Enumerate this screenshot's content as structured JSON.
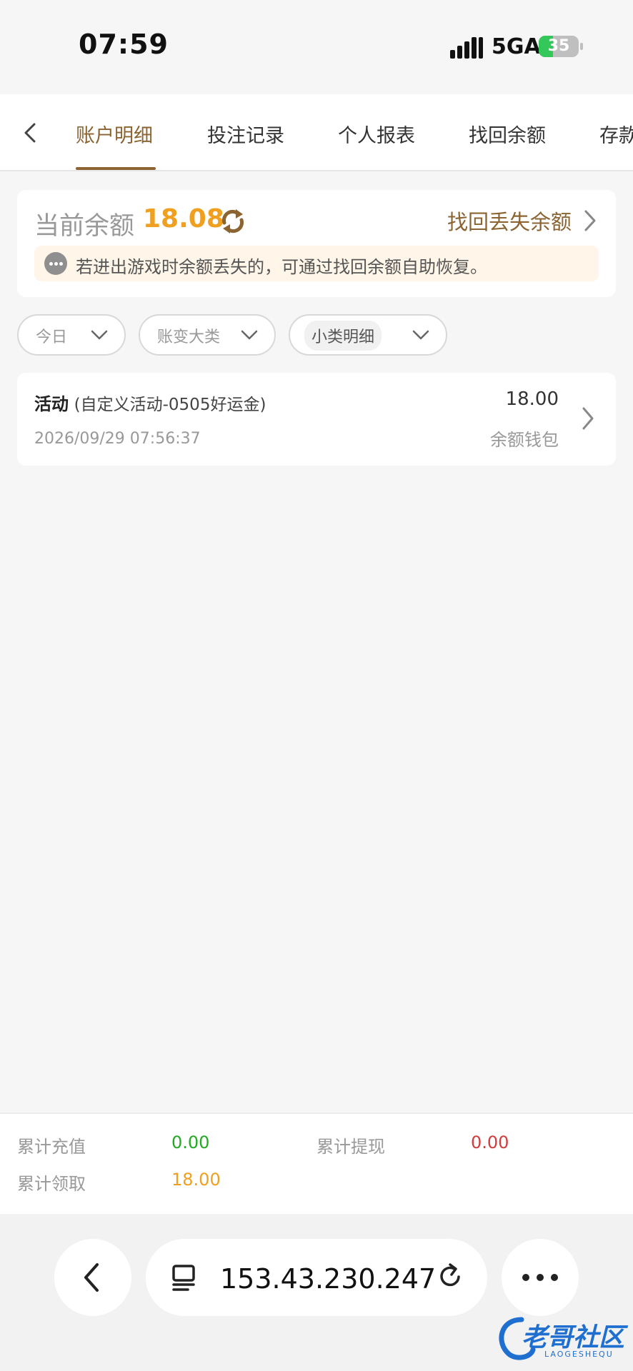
{
  "status_bar": {
    "time": "07:59",
    "network": "5GA",
    "battery": "35",
    "battery_level": 0.35
  },
  "tabs": [
    {
      "label": "账户明细",
      "active": true
    },
    {
      "label": "投注记录",
      "active": false
    },
    {
      "label": "个人报表",
      "active": false
    },
    {
      "label": "找回余额",
      "active": false
    },
    {
      "label": "存款",
      "active": false
    }
  ],
  "balance": {
    "label": "当前余额",
    "value": "18.08",
    "recover_link": "找回丢失余额",
    "tip": "若进出游戏时余额丢失的，可通过找回余额自助恢复。"
  },
  "filters": [
    {
      "label": "今日"
    },
    {
      "label": "账变大类"
    },
    {
      "label": "小类明细"
    }
  ],
  "records": [
    {
      "type": "活动",
      "detail": "(自定义活动-0505好运金)",
      "time": "2026/09/29 07:56:37",
      "amount": "18.00",
      "wallet": "余额钱包"
    }
  ],
  "summary": {
    "recharge_label": "累计充值",
    "recharge_value": "0.00",
    "withdraw_label": "累计提现",
    "withdraw_value": "0.00",
    "claim_label": "累计领取",
    "claim_value": "18.00"
  },
  "browser": {
    "url": "153.43.230.247"
  },
  "watermark": {
    "text": "老哥社区",
    "sub": "LAOGESHEQU"
  },
  "colors": {
    "accent": "#8b6432",
    "balance": "#f0a020",
    "green": "#22aa22",
    "red": "#d23c3c"
  }
}
